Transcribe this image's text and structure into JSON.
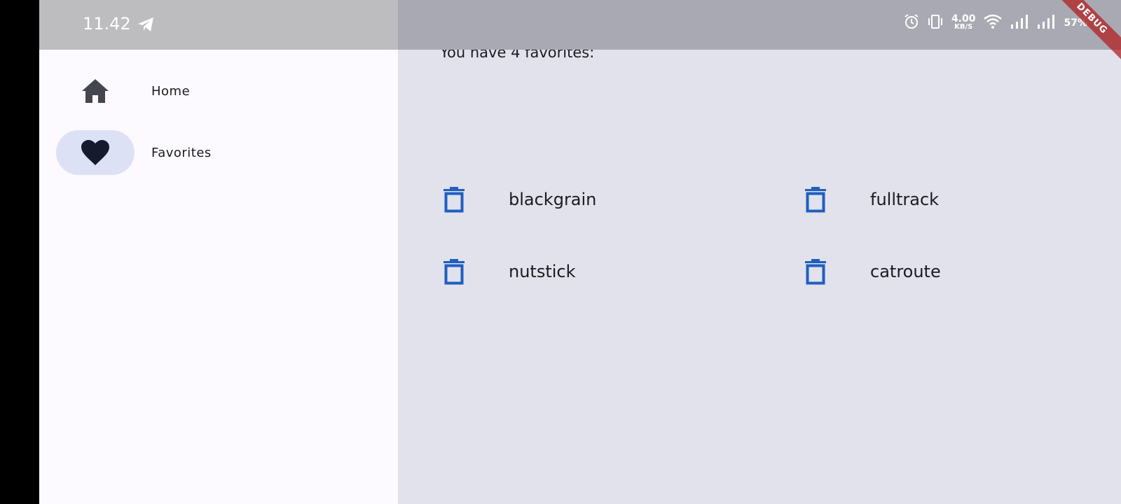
{
  "status_bar": {
    "time": "11.42",
    "net_rate_value": "4.00",
    "net_rate_unit": "KB/S",
    "battery": "57%",
    "icons": [
      "telegram-icon",
      "alarm-icon",
      "vibrate-icon",
      "wifi-icon",
      "signal-icon",
      "signal-icon"
    ]
  },
  "nav": {
    "items": [
      {
        "label": "Home",
        "icon": "home-icon",
        "selected": false
      },
      {
        "label": "Favorites",
        "icon": "heart-icon",
        "selected": true
      }
    ]
  },
  "favorites": {
    "header": "You have 4 favorites:",
    "items": [
      {
        "label": "blackgrain",
        "icon": "delete-icon"
      },
      {
        "label": "fulltrack",
        "icon": "delete-icon"
      },
      {
        "label": "nutstick",
        "icon": "delete-icon"
      },
      {
        "label": "catroute",
        "icon": "delete-icon"
      }
    ]
  },
  "debug_banner": "DEBUG",
  "colors": {
    "rail_bg": "#fcfaff",
    "content_bg": "#e1e2ec",
    "indicator": "#dde1f6",
    "accent": "#1f5fbf",
    "text": "#1b1b1f"
  }
}
